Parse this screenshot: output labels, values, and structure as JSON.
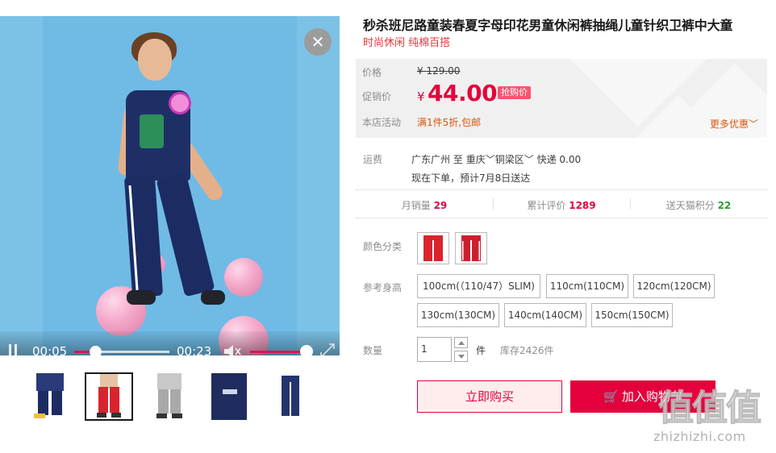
{
  "product": {
    "title": "秒杀班尼路童装春夏字母印花男童休闲裤抽绳儿童针织卫裤中大童",
    "subtitle": "时尚休闲 纯棉百搭"
  },
  "video": {
    "current_time": "00:05",
    "duration": "00:23",
    "progress": 0.22,
    "volume": 1.0
  },
  "gallery": {
    "thumbnails": [
      {
        "icon": "navy-jogger-pants-photo",
        "active": false
      },
      {
        "icon": "red-jogger-pants-photo",
        "active": true
      },
      {
        "icon": "grey-jogger-pants-photo",
        "active": false
      },
      {
        "icon": "navy-pants-detail-photo",
        "active": false
      },
      {
        "icon": "navy-pants-flat-photo",
        "active": false
      }
    ]
  },
  "price": {
    "orig_label": "价格",
    "orig_value": "129.00",
    "sale_label": "促销价",
    "currency": "¥",
    "sale_value": "44.00",
    "badge": "抢购价",
    "promo_label": "本店活动",
    "promo_text": "满1件5折,包邮",
    "more_promo": "更多优惠"
  },
  "shipping": {
    "label": "运费",
    "from": "广东广州",
    "to_word": "至",
    "to_city": "重庆",
    "to_district": "铜梁区",
    "method": "快递",
    "fee": "0.00",
    "note": "现在下单，预计7月8日送达"
  },
  "stats": {
    "monthly_sales_label": "月销量",
    "monthly_sales": "29",
    "reviews_label": "累计评价",
    "reviews": "1289",
    "points_label": "送天猫积分",
    "points": "22"
  },
  "options": {
    "color_label": "颜色分类",
    "colors": [
      {
        "icon": "red-pants-swatch-icon",
        "color": "#d9242d"
      },
      {
        "icon": "red-striped-pants-swatch-icon",
        "color": "#c9202f"
      }
    ],
    "size_label": "参考身高",
    "sizes": [
      "100cm(（110/47）SLIM)",
      "110cm(110CM)",
      "120cm(120CM)",
      "130cm(130CM)",
      "140cm(140CM)",
      "150cm(150CM)"
    ]
  },
  "quantity": {
    "label": "数量",
    "value": "1",
    "unit": "件",
    "stock": "库存2426件"
  },
  "actions": {
    "buy_now": "立即购买",
    "add_cart": "加入购物车"
  },
  "watermark": {
    "logo": "值值值",
    "url": "zhizhizhi.com"
  },
  "colors": {
    "accent": "#e4003c",
    "promo": "#d8560e",
    "badge": "#f3556f",
    "sky": "#6fbbe6",
    "balloon": "#f3a7c9"
  }
}
